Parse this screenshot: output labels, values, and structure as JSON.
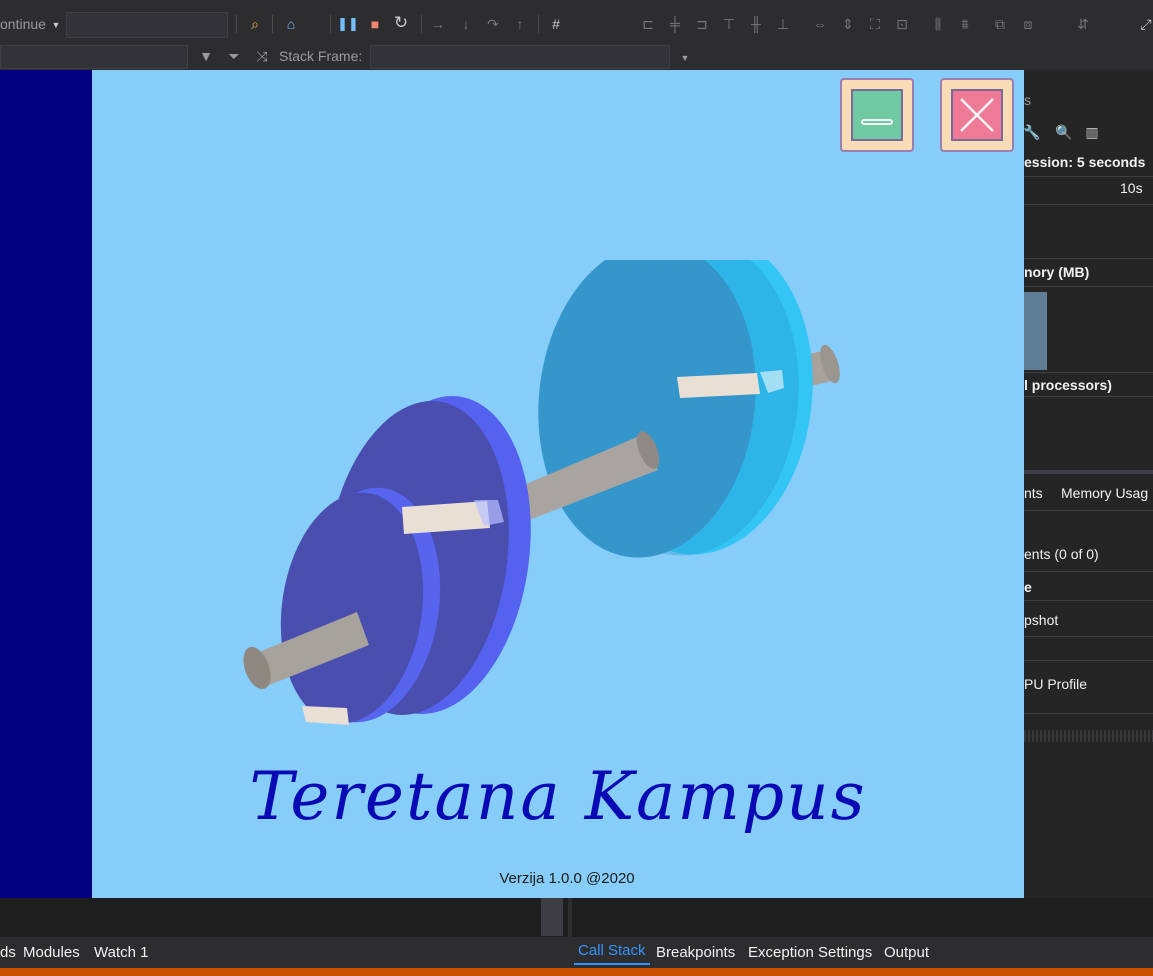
{
  "ide": {
    "toolbar": {
      "continue_label": "ontinue",
      "stack_frame_label": "Stack Frame:"
    },
    "right_panel": {
      "icon_s": "s",
      "session_text": "ession: 5 seconds",
      "timeline_tick": "10s",
      "memory_header": "nory (MB)",
      "cpu_header": "l processors)",
      "tabs": [
        "nts",
        "Memory Usag"
      ],
      "events_text": "ents (0 of 0)",
      "usage_text": "e",
      "snapshot_text": "pshot",
      "cpu_profile_text": "PU Profile"
    },
    "bottom_tabs_left": [
      "ds",
      "Modules",
      "Watch 1"
    ],
    "bottom_tabs_right": [
      "Call Stack",
      "Breakpoints",
      "Exception Settings",
      "Output"
    ],
    "active_tab": "Call Stack",
    "accent_color": "#3794ff",
    "status_color": "#ca5100"
  },
  "app": {
    "title": "Teretana Kampus",
    "version": "Verzija 1.0.0 @2020",
    "background_color": "#87cdf9",
    "sidebar_color": "#000080",
    "buttons": {
      "minimize_icon": "minimize-icon",
      "close_icon": "close-icon"
    },
    "illustration": "dumbbell"
  }
}
